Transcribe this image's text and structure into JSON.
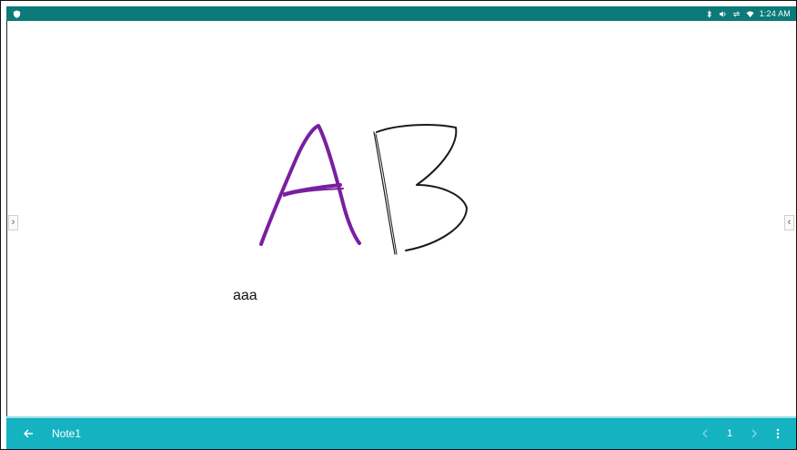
{
  "status_bar": {
    "time": "1:24 AM",
    "icons": [
      "shield-icon",
      "bluetooth-icon",
      "volume-icon",
      "sync-icon",
      "wifi-icon"
    ]
  },
  "canvas": {
    "handwriting": [
      {
        "text": "A",
        "color": "#7a1fa0"
      },
      {
        "text": "B",
        "color": "#1a1a1a"
      }
    ],
    "typed_text": "aaa"
  },
  "side_buttons": {
    "left": "›",
    "right": "‹"
  },
  "bottom_bar": {
    "title": "Note1",
    "page": "1",
    "background": "#15b2c1",
    "icons": [
      "back-arrow-icon",
      "chevron-left-icon",
      "chevron-right-icon",
      "more-vert-icon"
    ]
  }
}
